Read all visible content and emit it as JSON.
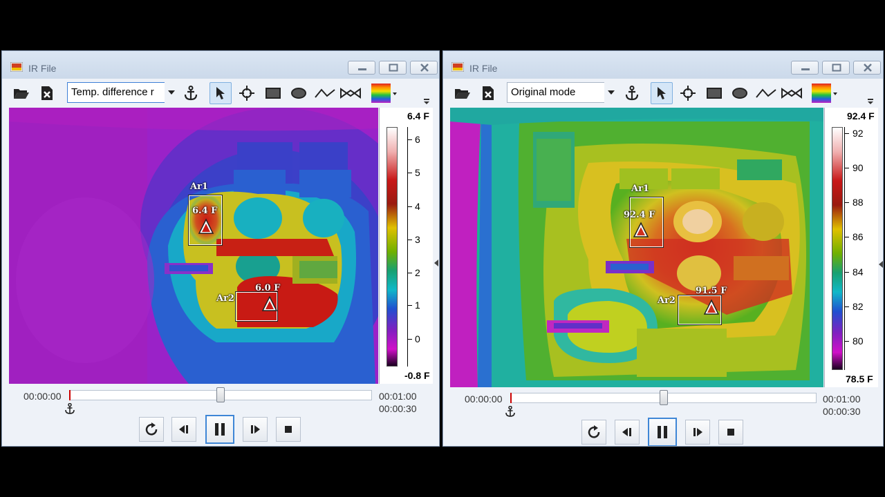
{
  "colors": {
    "accent": "#3e86d6",
    "desktop": "#000000"
  },
  "windows": [
    {
      "title": "IR File",
      "mode": "Temp. difference r",
      "scale": {
        "max": "6.4 F",
        "min": "-0.8 F",
        "ticks": [
          "6",
          "5",
          "4",
          "3",
          "2",
          "1",
          "0"
        ]
      },
      "rois": [
        {
          "name": "Ar1",
          "temp": "6.4 F"
        },
        {
          "name": "Ar2",
          "temp": "6.0 F"
        }
      ],
      "player": {
        "current": "00:00:00",
        "duration": "00:01:00",
        "elapsed": "00:00:30",
        "position": 0.5
      }
    },
    {
      "title": "IR File",
      "mode": "Original mode",
      "scale": {
        "max": "92.4 F",
        "min": "78.5 F",
        "ticks": [
          "92",
          "90",
          "88",
          "86",
          "84",
          "82",
          "80"
        ]
      },
      "rois": [
        {
          "name": "Ar1",
          "temp": "92.4 F"
        },
        {
          "name": "Ar2",
          "temp": "91.5 F"
        }
      ],
      "player": {
        "current": "00:00:00",
        "duration": "00:01:00",
        "elapsed": "00:00:30",
        "position": 0.5
      }
    }
  ],
  "icons": {
    "toolbar": [
      "folder-open-icon",
      "close-file-icon",
      "anchor-icon",
      "pointer-icon",
      "spot-tool-icon",
      "rectangle-tool-icon",
      "ellipse-tool-icon",
      "line-tool-icon",
      "polygon-tool-icon",
      "palette-icon"
    ],
    "playback": [
      "loop-icon",
      "step-back-icon",
      "pause-icon",
      "step-forward-icon",
      "stop-icon"
    ]
  }
}
